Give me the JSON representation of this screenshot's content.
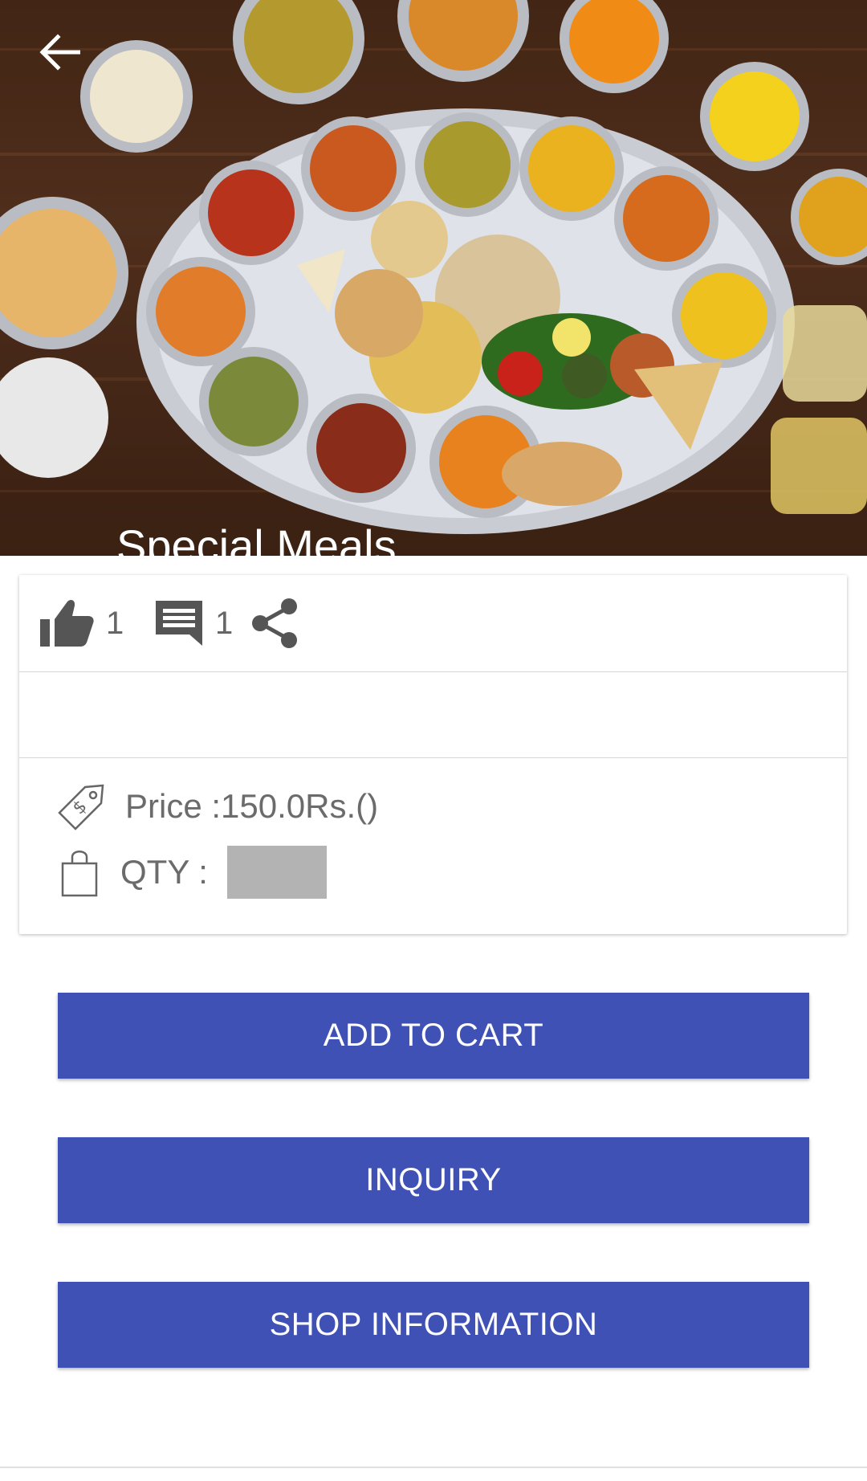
{
  "header": {
    "title": "Special Meals"
  },
  "stats": {
    "likes": "1",
    "comments": "1"
  },
  "product": {
    "price_text": "Price :150.0Rs.()",
    "qty_label": "QTY :",
    "qty_value": ""
  },
  "buttons": {
    "add_to_cart": "ADD TO CART",
    "inquiry": "INQUIRY",
    "shop_information": "SHOP INFORMATION"
  },
  "colors": {
    "primary": "#3f51b5",
    "icon_gray": "#555555",
    "text_gray": "#6b6b6b"
  },
  "icons": {
    "back": "arrow-left-icon",
    "like": "thumbs-up-icon",
    "comment": "comment-icon",
    "share": "share-icon",
    "price": "price-tag-icon",
    "qty": "shopping-bag-icon"
  }
}
